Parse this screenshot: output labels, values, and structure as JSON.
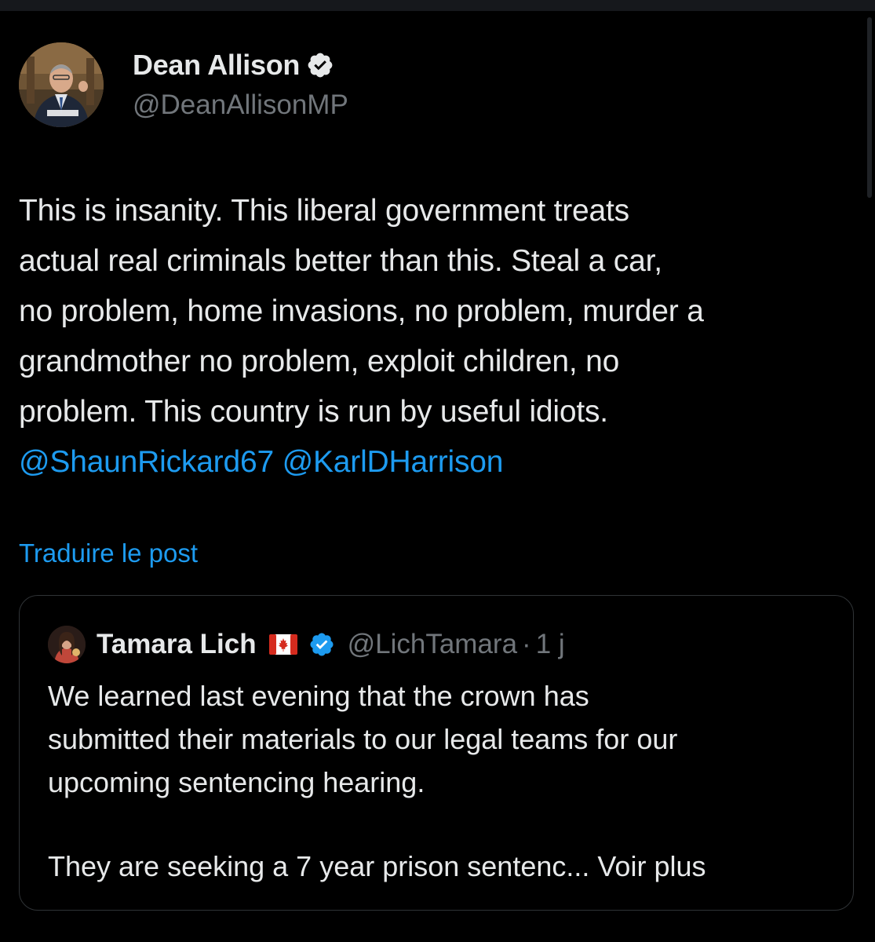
{
  "tweet": {
    "author": {
      "name": "Dean Allison",
      "handle": "@DeanAllisonMP",
      "verified": true
    },
    "text": "This is insanity.  This liberal government treats\nactual real criminals better than this. Steal a car,\nno problem, home invasions, no problem, murder a\ngrandmother no problem, exploit children, no\nproblem.  This country is run by useful idiots.",
    "mentions": [
      "@ShaunRickard67",
      "@KarlDHarrison"
    ],
    "translate_label": "Traduire le post"
  },
  "quoted_tweet": {
    "author": {
      "name": "Tamara Lich",
      "handle": "@LichTamara",
      "verified": true,
      "flag": "canada-flag-icon"
    },
    "separator": "·",
    "time": "1 j",
    "text": "We learned last evening that the crown has\nsubmitted their materials to our legal teams for our\nupcoming sentencing hearing.",
    "truncated_line": "They are seeking a 7 year prison sentenc...",
    "see_more_label": "Voir plus"
  },
  "colors": {
    "background": "#000000",
    "text": "#e7e9ea",
    "muted": "#71767b",
    "link": "#1d9bf0",
    "border": "#2f3336"
  }
}
